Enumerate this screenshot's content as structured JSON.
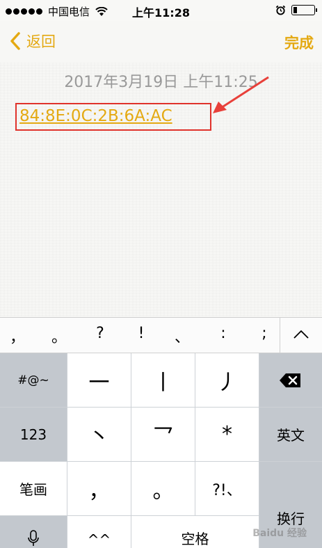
{
  "status_bar": {
    "carrier": "中国电信",
    "time": "上午11:28"
  },
  "nav": {
    "back_label": "返回",
    "done_label": "完成"
  },
  "note": {
    "date": "2017年3月19日 上午11:25",
    "mac_address": "84:8E:0C:2B:6A:AC"
  },
  "punctuation": [
    "，",
    "。",
    "?",
    "!",
    "、",
    ":",
    ";"
  ],
  "keyboard": {
    "symbols_key": "#@~",
    "numbers_key": "123",
    "strokes_key": "笔画",
    "english_key": "英文",
    "return_key": "换行",
    "space_key": "空格",
    "stroke_1": "一",
    "stroke_2": "丨",
    "stroke_3": "丿",
    "stroke_4": "丶",
    "stroke_5": "乛",
    "wildcard": "*",
    "comma": "，",
    "period": "。",
    "punct_combo": "?!、",
    "emoticon": "^^"
  },
  "watermark": "Baidu 经验",
  "colors": {
    "accent": "#e4a912",
    "highlight_box": "#e0322b",
    "arrow": "#e8403a"
  }
}
